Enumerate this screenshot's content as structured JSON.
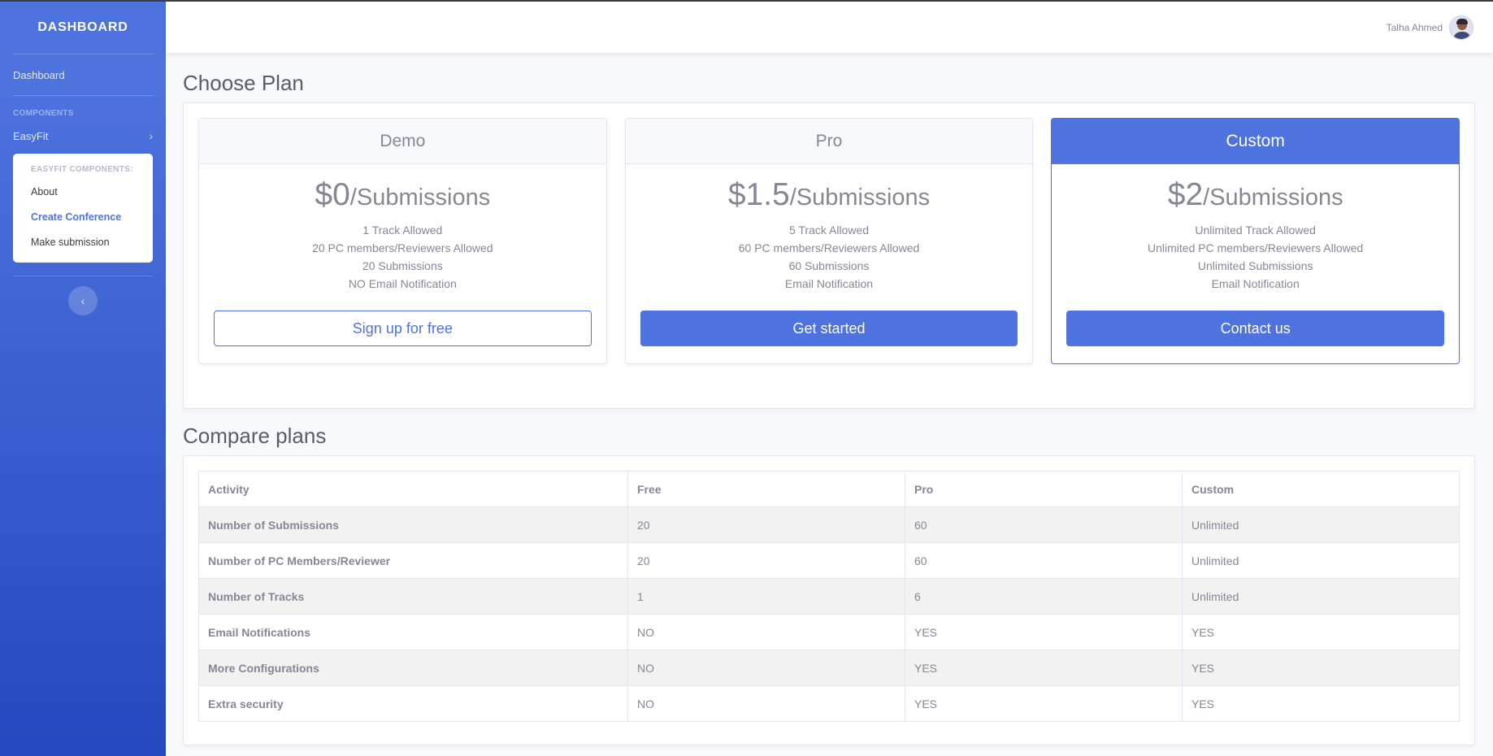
{
  "sidebar": {
    "brand": "DASHBOARD",
    "dashboard_link": "Dashboard",
    "components_heading": "COMPONENTS",
    "easyfit_link": "EasyFit",
    "collapse_header": "EASYFIT COMPONENTS:",
    "items": [
      {
        "label": "About",
        "active": false
      },
      {
        "label": "Create Conference",
        "active": true
      },
      {
        "label": "Make submission",
        "active": false
      }
    ]
  },
  "topbar": {
    "user_name": "Talha Ahmed"
  },
  "choose_plan": {
    "title": "Choose Plan",
    "plans": [
      {
        "name": "Demo",
        "price": "$0",
        "per": "/Submissions",
        "features": [
          "1 Track Allowed",
          "20 PC members/Reviewers Allowed",
          "20 Submissions",
          "NO Email Notification"
        ],
        "button": "Sign up for free"
      },
      {
        "name": "Pro",
        "price": "$1.5",
        "per": "/Submissions",
        "features": [
          "5 Track Allowed",
          "60 PC members/Reviewers Allowed",
          "60 Submissions",
          "Email Notification"
        ],
        "button": "Get started"
      },
      {
        "name": "Custom",
        "price": "$2",
        "per": "/Submissions",
        "features": [
          "Unlimited Track Allowed",
          "Unlimited PC members/Reviewers Allowed",
          "Unlimited Submissions",
          "Email Notification"
        ],
        "button": "Contact us"
      }
    ]
  },
  "compare": {
    "title": "Compare plans",
    "headers": [
      "Activity",
      "Free",
      "Pro",
      "Custom"
    ],
    "rows": [
      [
        "Number of Submissions",
        "20",
        "60",
        "Unlimited"
      ],
      [
        "Number of PC Members/Reviewer",
        "20",
        "60",
        "Unlimited"
      ],
      [
        "Number of Tracks",
        "1",
        "6",
        "Unlimited"
      ],
      [
        "Email Notifications",
        "NO",
        "YES",
        "YES"
      ],
      [
        "More Configurations",
        "NO",
        "YES",
        "YES"
      ],
      [
        "Extra security",
        "NO",
        "YES",
        "YES"
      ]
    ]
  },
  "colors": {
    "primary": "#4e73df",
    "text_muted": "#858796"
  }
}
